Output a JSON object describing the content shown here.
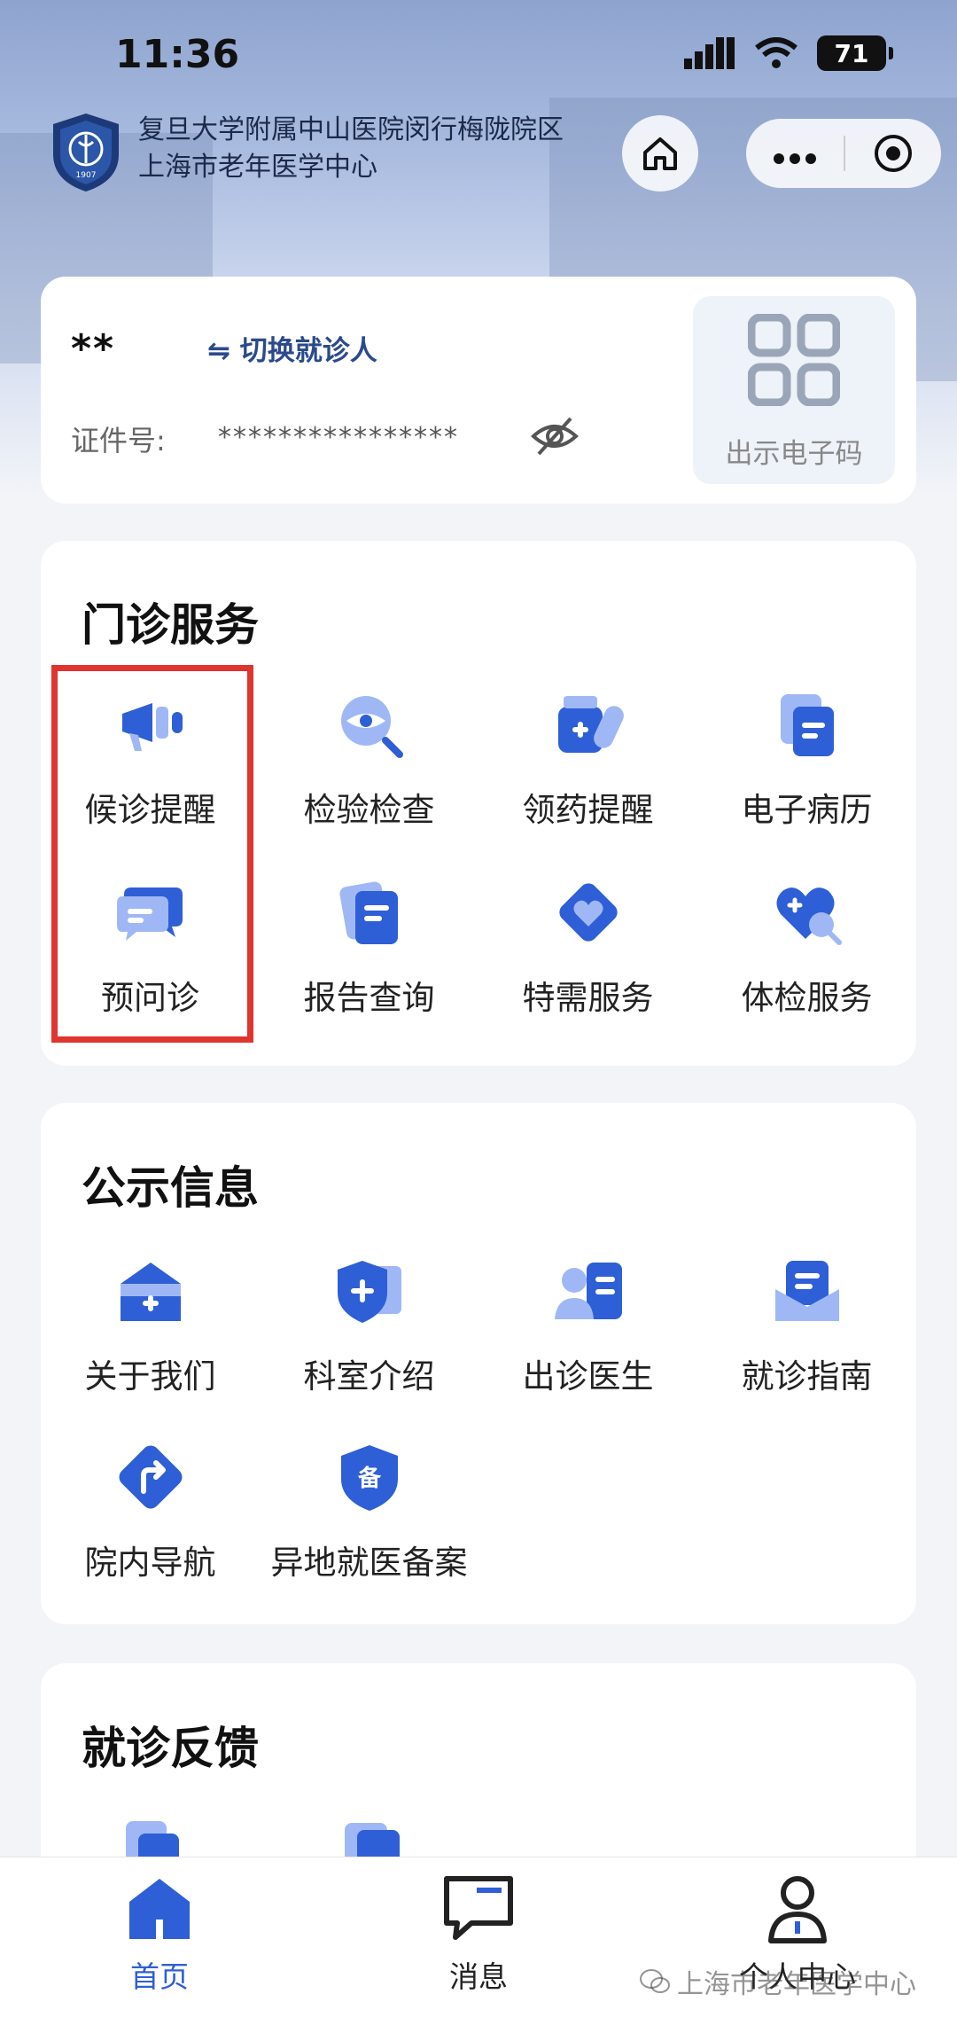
{
  "status_bar": {
    "time": "11:36",
    "battery": "71"
  },
  "header": {
    "hospital_name_line1": "复旦大学附属中山医院闵行梅陇院区",
    "hospital_name_line2": "上海市老年医学中心",
    "logo_text": "1907"
  },
  "patient": {
    "name": "**",
    "switch_label": "⇋ 切换就诊人",
    "id_label": "证件号:",
    "id_value": "****************",
    "qr_label": "出示电子码"
  },
  "outpatient": {
    "title": "门诊服务",
    "items": [
      {
        "label": "候诊提醒",
        "icon": "megaphone-icon"
      },
      {
        "label": "检验检查",
        "icon": "magnifier-eye-icon"
      },
      {
        "label": "领药提醒",
        "icon": "medicine-icon"
      },
      {
        "label": "电子病历",
        "icon": "records-icon"
      },
      {
        "label": "预问诊",
        "icon": "chat-bubbles-icon"
      },
      {
        "label": "报告查询",
        "icon": "report-icon"
      },
      {
        "label": "特需服务",
        "icon": "heart-diamond-icon"
      },
      {
        "label": "体检服务",
        "icon": "heart-search-icon"
      }
    ]
  },
  "public_info": {
    "title": "公示信息",
    "items": [
      {
        "label": "关于我们",
        "icon": "hospital-icon"
      },
      {
        "label": "科室介绍",
        "icon": "shield-cross-icon"
      },
      {
        "label": "出诊医生",
        "icon": "doctor-icon"
      },
      {
        "label": "就诊指南",
        "icon": "guide-icon"
      },
      {
        "label": "院内导航",
        "icon": "navigation-icon"
      },
      {
        "label": "异地就医备案",
        "icon": "filing-badge-icon"
      }
    ],
    "badge_char": "备"
  },
  "feedback": {
    "title": "就诊反馈"
  },
  "tabbar": {
    "tabs": [
      {
        "label": "首页",
        "active": true
      },
      {
        "label": "消息",
        "active": false
      },
      {
        "label": "个人中心",
        "active": false
      }
    ]
  },
  "watermark": "上海市老年医学中心",
  "colors": {
    "accent": "#2f5fd6",
    "icon_light": "#9fb8f5",
    "highlight": "#e0342f"
  }
}
